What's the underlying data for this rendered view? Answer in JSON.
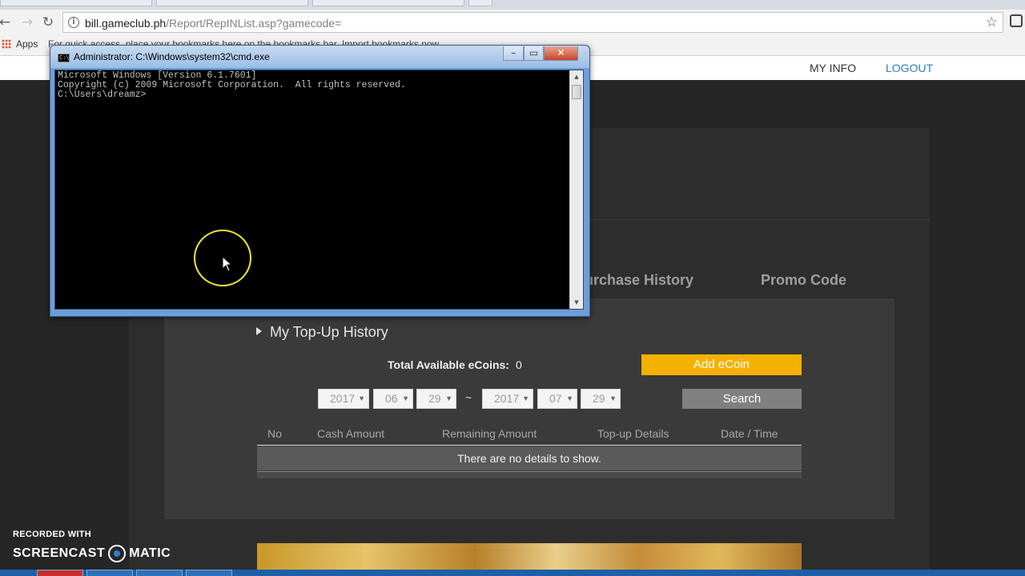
{
  "browser": {
    "url_host": "bill.gameclub.ph",
    "url_path": "/Report/RepINList.asp?gamecode=",
    "bookmarks_apps": "Apps",
    "bookmarks_hint": "For quick access, place your bookmarks here on the bookmarks bar. Import bookmarks now..."
  },
  "site": {
    "header": {
      "my_info": "MY INFO",
      "logout": "LOGOUT"
    },
    "tabs": [
      {
        "label": "urchase History"
      },
      {
        "label": "Promo Code"
      }
    ],
    "section_title": "My Top-Up History",
    "coins": {
      "label": "Total Available eCoins:",
      "value": "0"
    },
    "add_ecoin": "Add eCoin",
    "date_range": {
      "from": {
        "year": "2017",
        "month": "06",
        "day": "29"
      },
      "separator": "~",
      "to": {
        "year": "2017",
        "month": "07",
        "day": "29"
      }
    },
    "search_label": "Search",
    "table": {
      "columns": [
        "No",
        "Cash Amount",
        "Remaining Amount",
        "Top-up Details",
        "Date / Time"
      ],
      "empty_message": "There are no details to show."
    }
  },
  "cmd": {
    "title": "Administrator: C:\\Windows\\system32\\cmd.exe",
    "icon_text": "C:\\",
    "lines": [
      "Microsoft Windows [Version 6.1.7601]",
      "Copyright (c) 2009 Microsoft Corporation.  All rights reserved.",
      "",
      "C:\\Users\\dreamz>"
    ]
  },
  "watermark": {
    "line1": "RECORDED WITH",
    "word1": "SCREENCAST",
    "word2": "MATIC"
  }
}
